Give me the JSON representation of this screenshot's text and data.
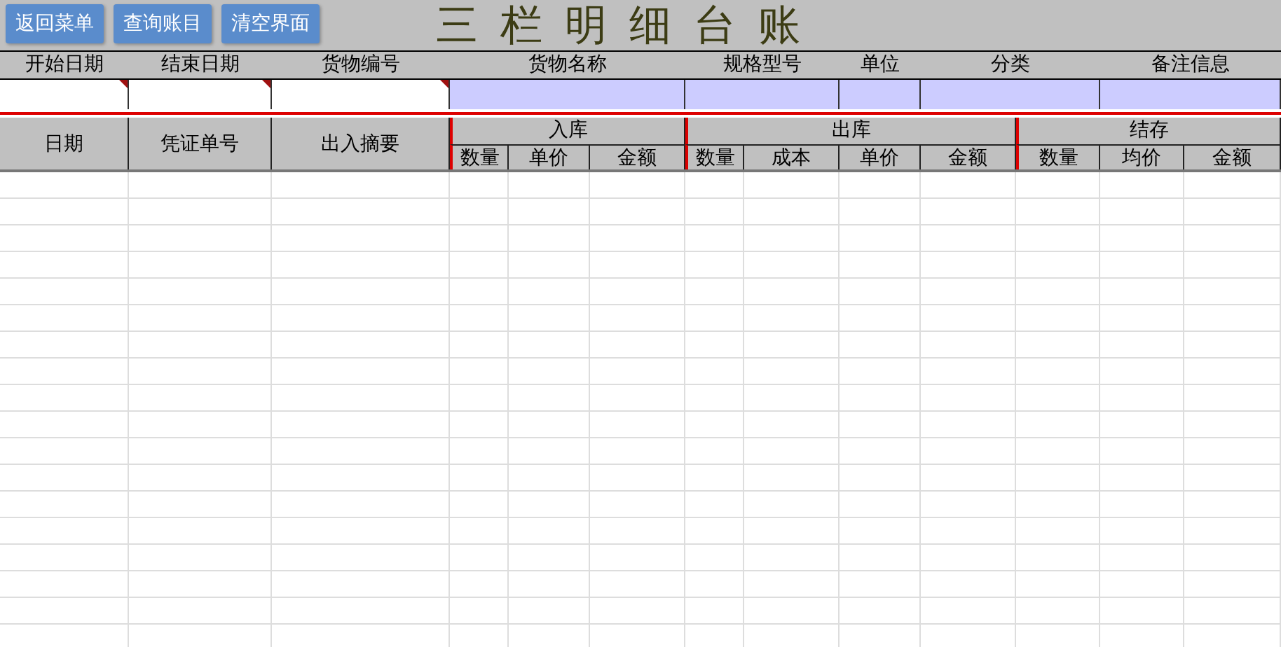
{
  "toolbar": {
    "buttons": [
      "返回菜单",
      "查询账目",
      "清空界面"
    ],
    "title": "三栏明细台账"
  },
  "filters": [
    {
      "label": "开始日期",
      "kind": "input",
      "comment": true
    },
    {
      "label": "结束日期",
      "kind": "input",
      "comment": true
    },
    {
      "label": "货物编号",
      "kind": "input",
      "comment": true
    },
    {
      "label": "货物名称",
      "kind": "readonly",
      "comment": false
    },
    {
      "label": "规格型号",
      "kind": "readonly",
      "comment": false
    },
    {
      "label": "单位",
      "kind": "readonly",
      "comment": false
    },
    {
      "label": "分类",
      "kind": "readonly",
      "comment": false
    },
    {
      "label": "备注信息",
      "kind": "readonly",
      "comment": false
    }
  ],
  "ledger": {
    "fixed_columns": [
      "日期",
      "凭证单号",
      "出入摘要"
    ],
    "groups": [
      {
        "title": "入库",
        "columns": [
          "数量",
          "单价",
          "金额"
        ]
      },
      {
        "title": "出库",
        "columns": [
          "数量",
          "成本",
          "单价",
          "金额"
        ]
      },
      {
        "title": "结存",
        "columns": [
          "数量",
          "均价",
          "金额"
        ]
      }
    ]
  }
}
